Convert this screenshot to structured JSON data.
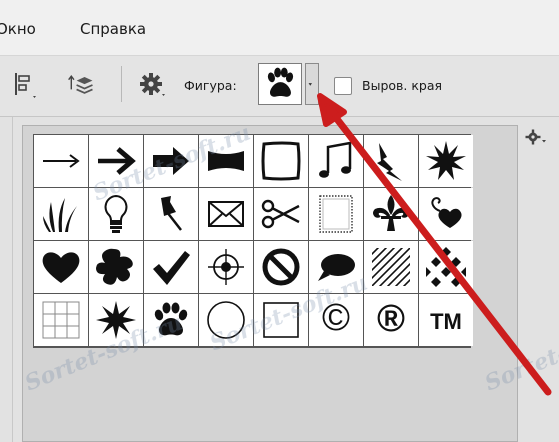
{
  "menubar": {
    "items": [
      {
        "label": "Окно"
      },
      {
        "label": "Справка"
      }
    ]
  },
  "options_bar": {
    "shape_label": "Фигура:",
    "selected_shape": "paw-print",
    "snap_edges_label": "Выров. края",
    "snap_edges_checked": false
  },
  "shape_grid": {
    "columns": 8,
    "rows": 4,
    "shapes": [
      [
        "arrow-thin",
        "arrow-bold",
        "arrow-heavy",
        "banner",
        "frame-rough",
        "music-notes",
        "lightning",
        "burst"
      ],
      [
        "grass",
        "lightbulb",
        "pushpin",
        "envelope",
        "scissors",
        "frame-stamp",
        "fleur-de-lis",
        "heart-curl"
      ],
      [
        "heart",
        "puzzle-blob",
        "checkmark",
        "target",
        "no-sign",
        "speech-bubble",
        "hatch-pattern",
        "checkerboard"
      ],
      [
        "grid",
        "starburst",
        "paw-print",
        "circle-frame",
        "square-frame",
        "copyright",
        "registered",
        "trademark"
      ]
    ],
    "symbols": {
      "copyright": "©",
      "registered": "®",
      "trademark": "TM"
    }
  },
  "watermark_text": "Sortet-soft.ru",
  "annotation_arrow_color": "#cc1d1d"
}
